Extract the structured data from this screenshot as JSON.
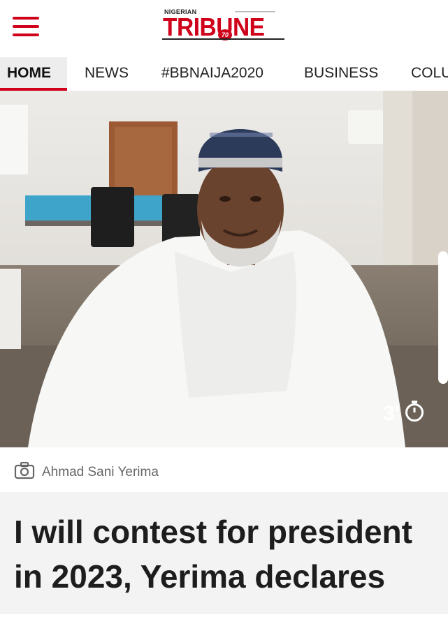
{
  "header": {
    "logo_small": "NIGERIAN",
    "logo_main": "TRIBUNE",
    "logo_anniversary": "70",
    "menu_icon": "hamburger-menu-icon",
    "brand_color": "#d0021b"
  },
  "nav": {
    "items": [
      {
        "label": "HOME",
        "active": true
      },
      {
        "label": "NEWS",
        "active": false
      },
      {
        "label": "#BBNAIJA2020",
        "active": false
      },
      {
        "label": "BUSINESS",
        "active": false
      },
      {
        "label": "COLU",
        "active": false
      }
    ]
  },
  "article": {
    "read_time": "3'",
    "read_time_icon": "stopwatch-icon",
    "photo_caption": "Ahmad Sani Yerima",
    "caption_icon": "camera-icon",
    "headline": "I will contest for president in 2023, Yerima declares"
  }
}
